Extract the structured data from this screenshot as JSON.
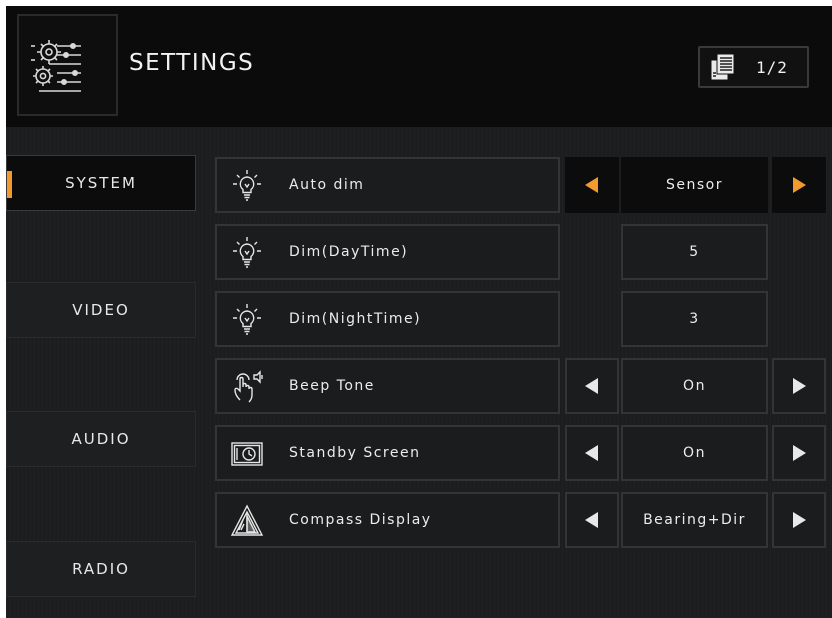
{
  "header": {
    "title": "SETTINGS",
    "page": "1/2",
    "icon": "settings-sliders-icon",
    "page_icon": "pages-icon"
  },
  "tabs": [
    {
      "label": "SYSTEM",
      "active": true
    },
    {
      "label": "VIDEO",
      "active": false
    },
    {
      "label": "AUDIO",
      "active": false
    },
    {
      "label": "RADIO",
      "active": false
    }
  ],
  "settings": [
    {
      "label": "Auto dim",
      "value": "Sensor",
      "icon": "light-bulb-icon",
      "has_arrows": true,
      "active": true
    },
    {
      "label": "Dim(DayTime)",
      "value": "5",
      "icon": "light-bulb-icon",
      "has_arrows": false,
      "active": false
    },
    {
      "label": "Dim(NightTime)",
      "value": "3",
      "icon": "light-bulb-icon",
      "has_arrows": false,
      "active": false
    },
    {
      "label": "Beep Tone",
      "value": "On",
      "icon": "touch-beep-icon",
      "has_arrows": true,
      "active": false
    },
    {
      "label": "Standby Screen",
      "value": "On",
      "icon": "standby-clock-icon",
      "has_arrows": true,
      "active": false
    },
    {
      "label": "Compass Display",
      "value": "Bearing+Dir",
      "icon": "compass-icon",
      "has_arrows": true,
      "active": false
    }
  ],
  "colors": {
    "accent": "#f29a2e",
    "arrow_default": "#e8e8e8",
    "background": "#1c1d1e",
    "header": "#0b0b0b"
  }
}
